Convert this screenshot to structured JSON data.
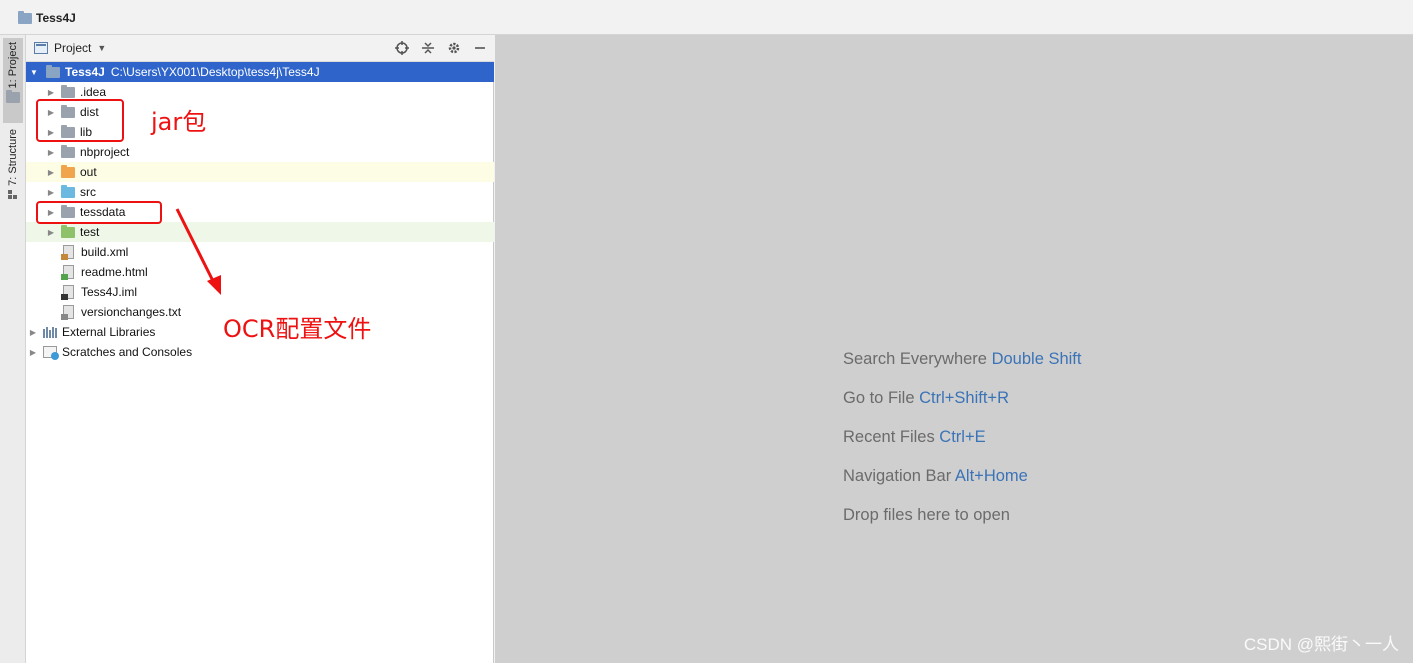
{
  "breadcrumb": {
    "project": "Tess4J"
  },
  "stripe": {
    "project_label": "1: Project",
    "structure_label": "7: Structure"
  },
  "panel": {
    "title": "Project",
    "tools": {
      "locate_icon": "crosshair-icon",
      "collapse_icon": "collapse-all-icon",
      "settings_icon": "gear-icon",
      "hide_icon": "minimize-icon"
    }
  },
  "tree": {
    "root": {
      "name": "Tess4J",
      "path": "C:\\Users\\YX001\\Desktop\\tess4j\\Tess4J"
    },
    "items": [
      {
        "name": ".idea",
        "kind": "folder-gray"
      },
      {
        "name": "dist",
        "kind": "folder-gray"
      },
      {
        "name": "lib",
        "kind": "folder-gray"
      },
      {
        "name": "nbproject",
        "kind": "folder-gray"
      },
      {
        "name": "out",
        "kind": "folder-orange"
      },
      {
        "name": "src",
        "kind": "folder-blue"
      },
      {
        "name": "tessdata",
        "kind": "folder-gray"
      },
      {
        "name": "test",
        "kind": "folder-green"
      },
      {
        "name": "build.xml",
        "kind": "file-xml"
      },
      {
        "name": "readme.html",
        "kind": "file-html"
      },
      {
        "name": "Tess4J.iml",
        "kind": "file-iml"
      },
      {
        "name": "versionchanges.txt",
        "kind": "file-txt"
      }
    ],
    "external_libraries": "External Libraries",
    "scratches": "Scratches and Consoles"
  },
  "annotations": {
    "jar": "jar包",
    "ocr": "OCR配置文件"
  },
  "editor": {
    "hints": [
      {
        "text": "Search Everywhere",
        "key": "Double Shift"
      },
      {
        "text": "Go to File",
        "key": "Ctrl+Shift+R"
      },
      {
        "text": "Recent Files",
        "key": "Ctrl+E"
      },
      {
        "text": "Navigation Bar",
        "key": "Alt+Home"
      },
      {
        "text": "Drop files here to open",
        "key": ""
      }
    ]
  },
  "watermark": "CSDN @熙街丶一人",
  "colors": {
    "selection": "#2f65ca",
    "annotation": "#ee1111",
    "shortcut": "#3b73b7",
    "editor_bg": "#cfcfcf"
  }
}
